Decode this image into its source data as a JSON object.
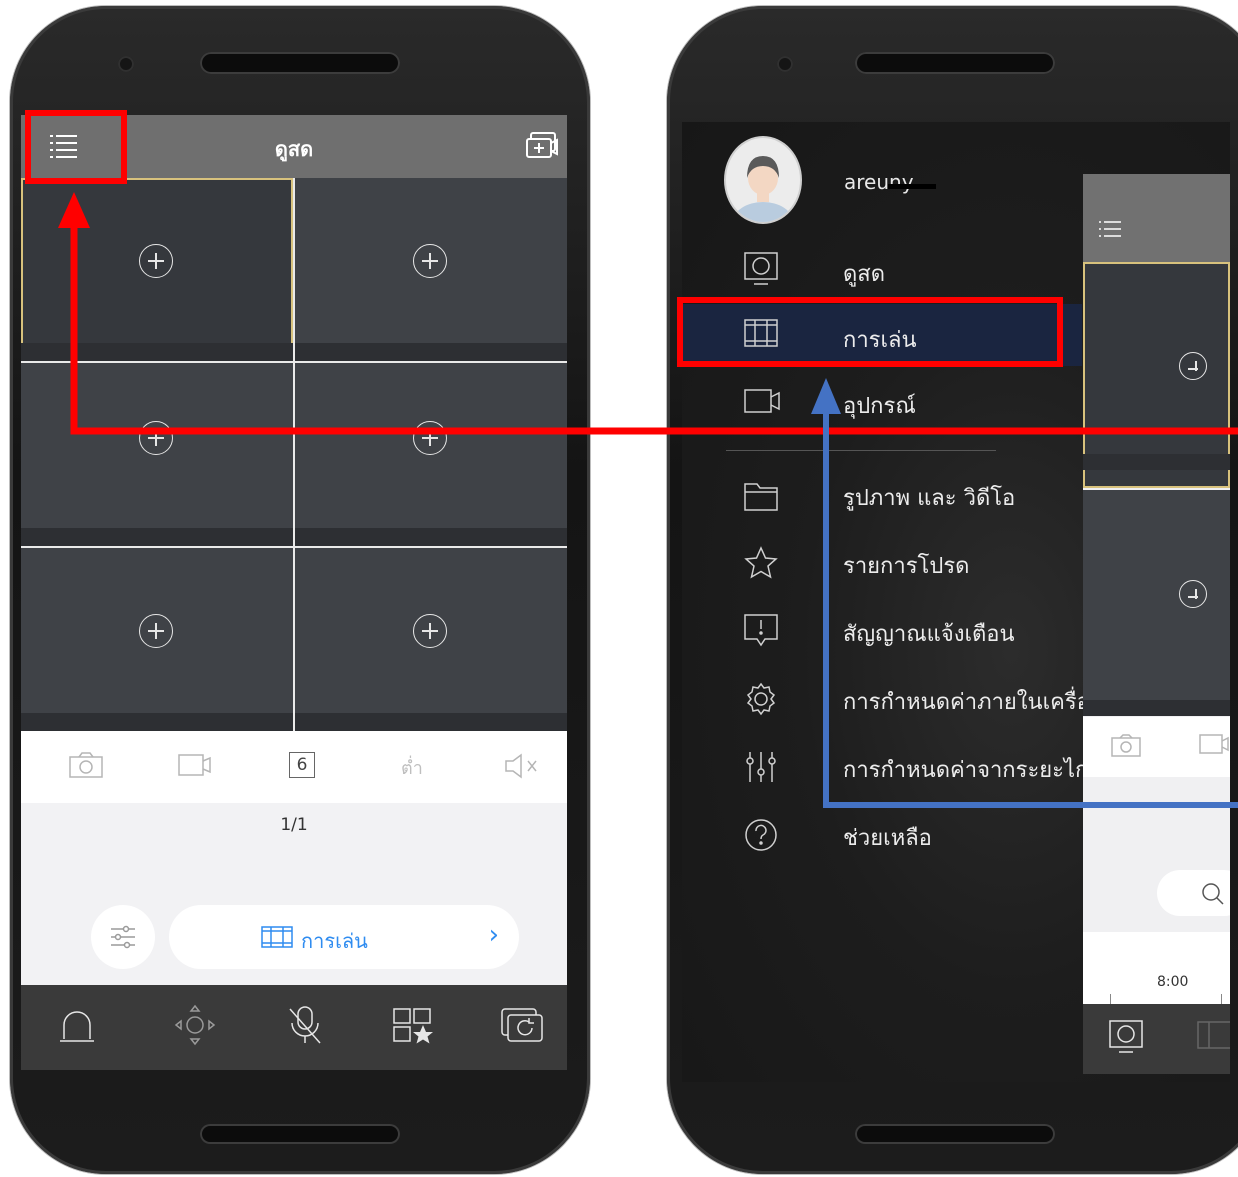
{
  "left_phone": {
    "header_title": "ดูสด",
    "tools": {
      "split_count": "6",
      "quality_label": "ต่ำ"
    },
    "page_indicator": "1/1",
    "playback_button_label": "การเล่น",
    "playback_chevron": "›",
    "icons": [
      "menu-icon",
      "multi-screen-icon",
      "camera-snapshot-icon",
      "video-record-icon",
      "mute-icon",
      "settings-sliders-icon",
      "alarm-icon",
      "ptz-icon",
      "mic-off-icon",
      "favorites-icon",
      "playback-refresh-icon"
    ]
  },
  "right_phone": {
    "username": "areuny",
    "menu_items": [
      {
        "label": "ดูสด",
        "icon": "monitor-icon"
      },
      {
        "label": "การเล่น",
        "icon": "film-icon",
        "active": true
      },
      {
        "label": "อุปกรณ์",
        "icon": "camera-device-icon"
      },
      {
        "label": "รูปภาพ และ วิดีโอ",
        "icon": "folder-icon"
      },
      {
        "label": "รายการโปรด",
        "icon": "star-icon"
      },
      {
        "label": "สัญญาณแจ้งเตือน",
        "icon": "alert-icon"
      },
      {
        "label": "การกำหนดค่าภายในเครื่อง",
        "icon": "gear-icon"
      },
      {
        "label": "การกำหนดค่าจากระยะไกล",
        "icon": "sliders-icon"
      },
      {
        "label": "ช่วยเหลือ",
        "icon": "help-icon"
      }
    ],
    "preview": {
      "timeline_label": "8:00"
    }
  },
  "colors": {
    "highlight_red": "#ff0000",
    "arrow_blue": "#4472c4",
    "accent_blue": "#2f8cf0",
    "selected_cell": "#d8c27d"
  }
}
